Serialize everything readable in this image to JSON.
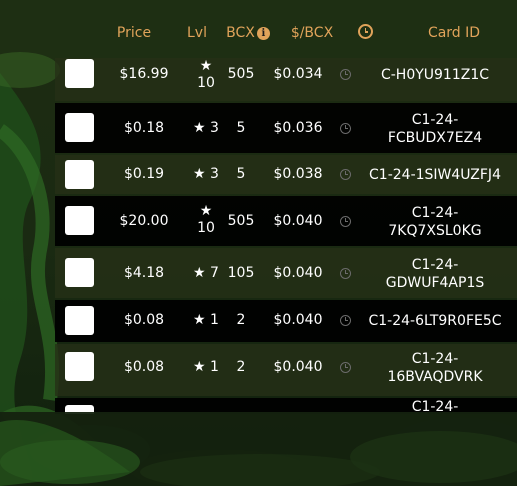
{
  "header": {
    "price": "Price",
    "lvl": "Lvl",
    "bcx": "BCX",
    "info_icon": "i",
    "per_bcx": "$/BCX",
    "card_id": "Card ID"
  },
  "star": "★",
  "rows": [
    {
      "price": "$16.99",
      "lvl": "10",
      "bcx": "505",
      "per_bcx": "$0.034",
      "card_id": "C-H0YU911Z1C"
    },
    {
      "price": "$0.18",
      "lvl": "3",
      "bcx": "5",
      "per_bcx": "$0.036",
      "card_id": "C1-24-FCBUDX7EZ4"
    },
    {
      "price": "$0.19",
      "lvl": "3",
      "bcx": "5",
      "per_bcx": "$0.038",
      "card_id": "C1-24-1SIW4UZFJ4"
    },
    {
      "price": "$20.00",
      "lvl": "10",
      "bcx": "505",
      "per_bcx": "$0.040",
      "card_id": "C1-24-7KQ7XSL0KG"
    },
    {
      "price": "$4.18",
      "lvl": "7",
      "bcx": "105",
      "per_bcx": "$0.040",
      "card_id": "C1-24-GDWUF4AP1S"
    },
    {
      "price": "$0.08",
      "lvl": "1",
      "bcx": "2",
      "per_bcx": "$0.040",
      "card_id": "C1-24-6LT9R0FE5C"
    },
    {
      "price": "$0.08",
      "lvl": "1",
      "bcx": "2",
      "per_bcx": "$0.040",
      "card_id": "C1-24-16BVAQDVRK"
    },
    {
      "card_id_partial": "C1-24-"
    }
  ],
  "colors": {
    "header_text": "#e0a35a",
    "row_dark": "#000000",
    "row_light": "#26301a",
    "text": "#ffffff",
    "clock_icon": "#6b6b6b"
  },
  "icons": {
    "bcx_info": "info-icon",
    "time_header": "clock-icon",
    "row_time": "clock-icon",
    "level": "star-icon"
  }
}
